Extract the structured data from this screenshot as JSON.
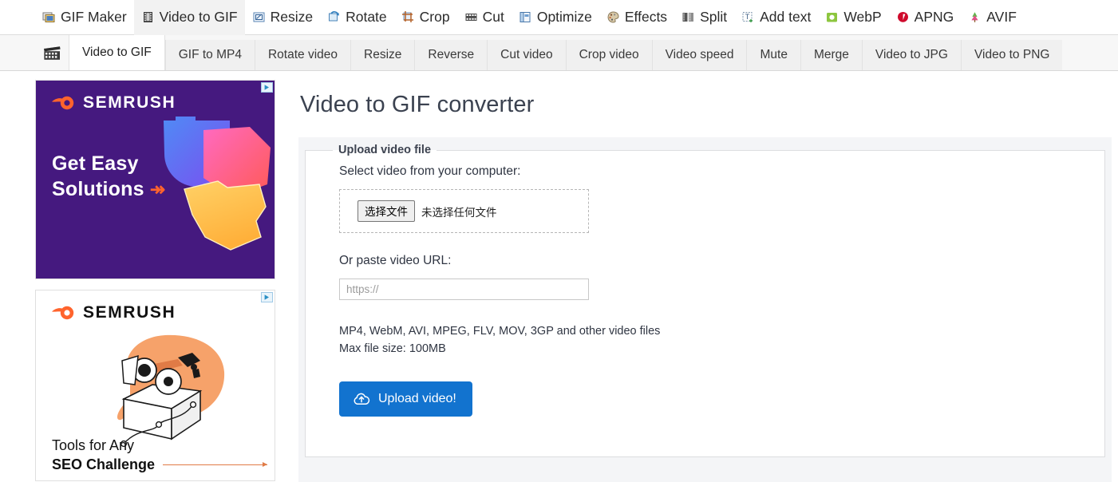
{
  "topnav": {
    "items": [
      {
        "label": "GIF Maker",
        "icon": "gif-maker-icon",
        "active": false
      },
      {
        "label": "Video to GIF",
        "icon": "film-strip-icon",
        "active": true
      },
      {
        "label": "Resize",
        "icon": "resize-icon",
        "active": false
      },
      {
        "label": "Rotate",
        "icon": "rotate-icon",
        "active": false
      },
      {
        "label": "Crop",
        "icon": "crop-icon",
        "active": false
      },
      {
        "label": "Cut",
        "icon": "cut-icon",
        "active": false
      },
      {
        "label": "Optimize",
        "icon": "optimize-icon",
        "active": false
      },
      {
        "label": "Effects",
        "icon": "effects-palette-icon",
        "active": false
      },
      {
        "label": "Split",
        "icon": "split-icon",
        "active": false
      },
      {
        "label": "Add text",
        "icon": "add-text-icon",
        "active": false
      },
      {
        "label": "WebP",
        "icon": "webp-icon",
        "active": false
      },
      {
        "label": "APNG",
        "icon": "apng-icon",
        "active": false
      },
      {
        "label": "AVIF",
        "icon": "avif-icon",
        "active": false
      }
    ]
  },
  "subnav": {
    "icon": "clapperboard-icon",
    "tabs": [
      {
        "label": "Video to GIF",
        "active": true
      },
      {
        "label": "GIF to MP4",
        "active": false
      },
      {
        "label": "Rotate video",
        "active": false
      },
      {
        "label": "Resize",
        "active": false
      },
      {
        "label": "Reverse",
        "active": false
      },
      {
        "label": "Cut video",
        "active": false
      },
      {
        "label": "Crop video",
        "active": false
      },
      {
        "label": "Video speed",
        "active": false
      },
      {
        "label": "Mute",
        "active": false
      },
      {
        "label": "Merge",
        "active": false
      },
      {
        "label": "Video to JPG",
        "active": false
      },
      {
        "label": "Video to PNG",
        "active": false
      }
    ]
  },
  "sidebar": {
    "ads": [
      {
        "brand": "SEMRUSH",
        "headline_line1": "Get Easy",
        "headline_line2": "Solutions",
        "arrow": "↠",
        "adchoices_label": "AdChoices",
        "background": "#45197f"
      },
      {
        "brand": "SEMRUSH",
        "footer_line1": "Tools for Any",
        "footer_line2": "SEO Challenge",
        "adchoices_label": "AdChoices",
        "background": "#ffffff"
      }
    ]
  },
  "main": {
    "title": "Video to GIF converter",
    "fieldset_legend": "Upload video file",
    "select_label": "Select video from your computer:",
    "file_button_label": "选择文件",
    "file_status": "未选择任何文件",
    "url_label": "Or paste video URL:",
    "url_value": "",
    "url_placeholder": "https://",
    "formats_note": "MP4, WebM, AVI, MPEG, FLV, MOV, 3GP and other video files",
    "size_note": "Max file size: 100MB",
    "upload_button_label": "Upload video!",
    "upload_button_icon": "cloud-upload-icon",
    "accent_color": "#1273cf"
  }
}
